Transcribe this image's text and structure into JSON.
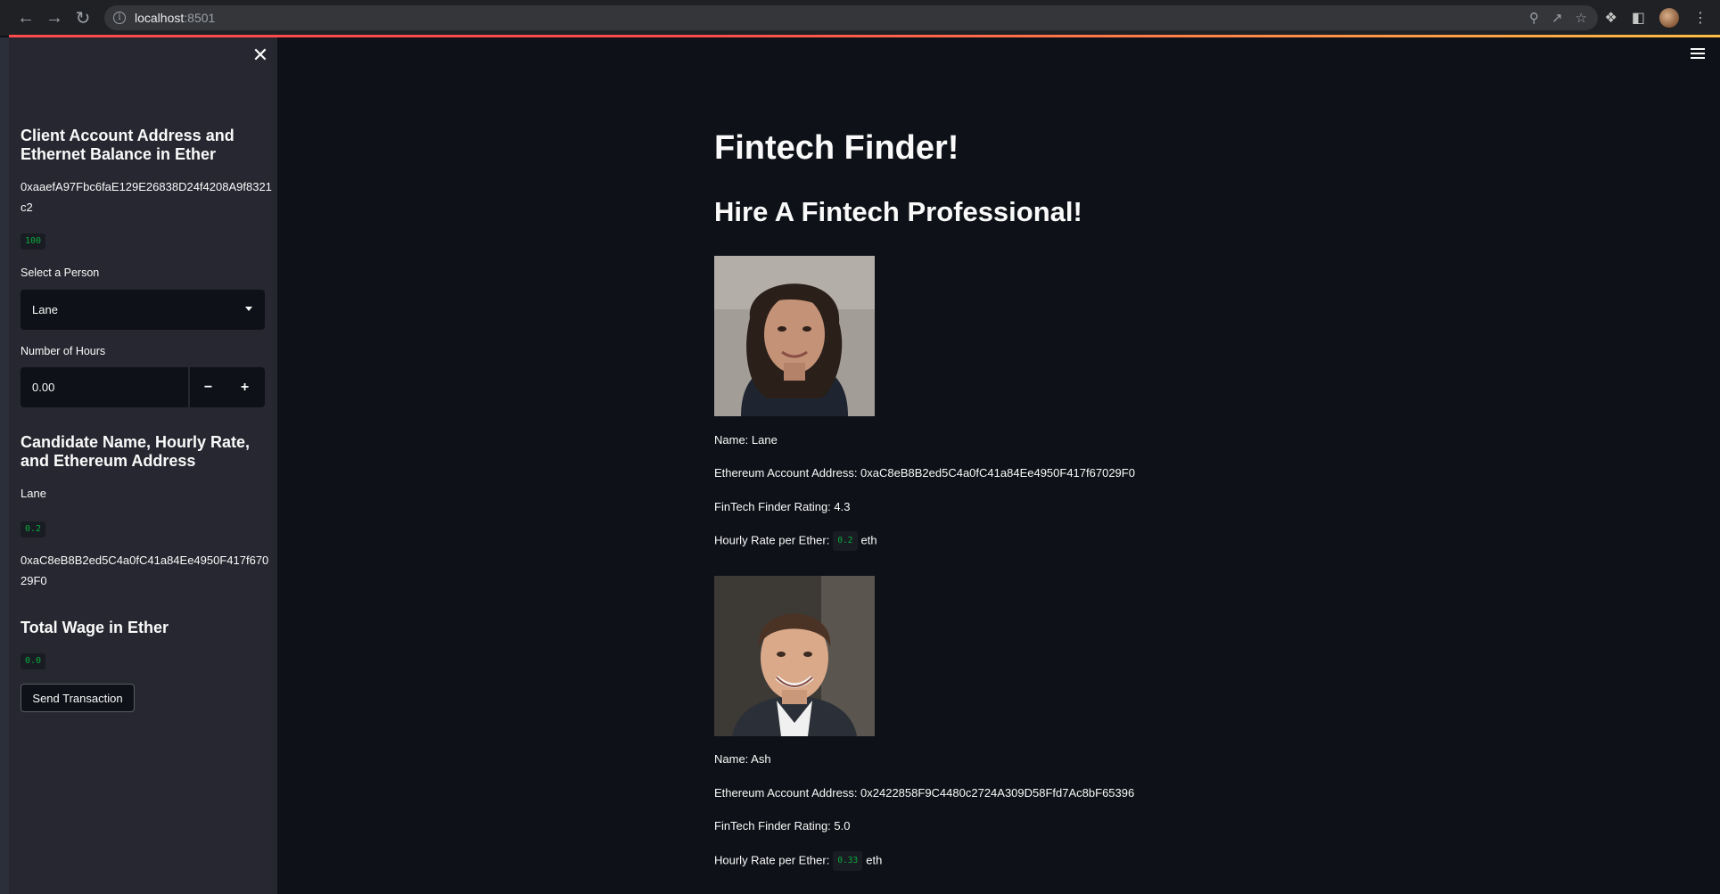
{
  "browser": {
    "url_host": "localhost",
    "url_port": ":8501"
  },
  "sidebar": {
    "heading_account": "Client Account Address and Ethernet Balance in Ether",
    "account_address": "0xaaefA97Fbc6faE129E26838D24f4208A9f8321c2",
    "balance": "100",
    "select_person_label": "Select a Person",
    "select_person_value": "Lane",
    "hours_label": "Number of Hours",
    "hours_value": "0.00",
    "minus_label": "−",
    "plus_label": "+",
    "heading_candidate": "Candidate Name, Hourly Rate, and Ethereum Address",
    "candidate_name": "Lane",
    "candidate_rate": "0.2",
    "candidate_address": "0xaC8eB8B2ed5C4a0fC41a84Ee4950F417f67029F0",
    "heading_wage": "Total Wage in Ether",
    "total_wage": "0.0",
    "send_button": "Send Transaction"
  },
  "main": {
    "title": "Fintech Finder!",
    "subtitle": "Hire A Fintech Professional!",
    "candidates": [
      {
        "name": "Name: Lane",
        "address": "Ethereum Account Address: 0xaC8eB8B2ed5C4a0fC41a84Ee4950F417f67029F0",
        "rating": "FinTech Finder Rating: 4.3",
        "rate_label": "Hourly Rate per Ether:",
        "rate_value": "0.2",
        "rate_unit": "eth"
      },
      {
        "name": "Name: Ash",
        "address": "Ethereum Account Address: 0x2422858F9C4480c2724A309D58Ffd7Ac8bF65396",
        "rating": "FinTech Finder Rating: 5.0",
        "rate_label": "Hourly Rate per Ether:",
        "rate_value": "0.33",
        "rate_unit": "eth"
      }
    ]
  },
  "colors": {
    "background": "#0e1117",
    "sidebar": "#262730",
    "code_green": "#09ab3b",
    "accent_red": "#ff4b4b"
  }
}
